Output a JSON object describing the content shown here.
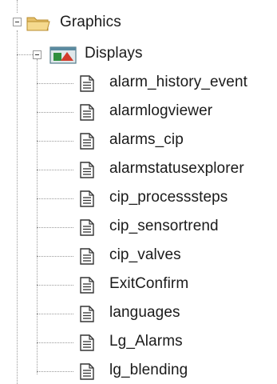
{
  "tree": {
    "root": {
      "label": "Graphics",
      "expanded": true
    },
    "folder": {
      "label": "Displays",
      "expanded": true
    },
    "items": [
      {
        "label": "alarm_history_event"
      },
      {
        "label": "alarmlogviewer"
      },
      {
        "label": "alarms_cip"
      },
      {
        "label": "alarmstatusexplorer"
      },
      {
        "label": "cip_processsteps"
      },
      {
        "label": "cip_sensortrend"
      },
      {
        "label": "cip_valves"
      },
      {
        "label": "ExitConfirm"
      },
      {
        "label": "languages"
      },
      {
        "label": "Lg_Alarms"
      },
      {
        "label": "lg_blending"
      }
    ]
  }
}
